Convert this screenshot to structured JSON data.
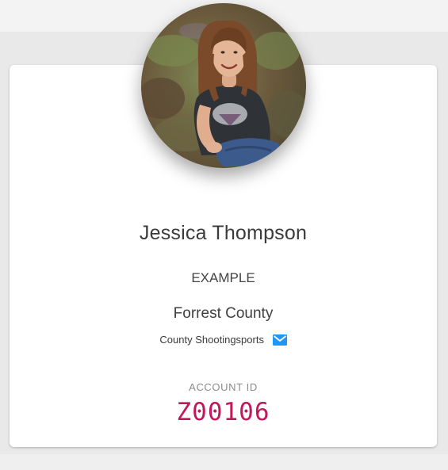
{
  "profile": {
    "name": "Jessica Thompson",
    "role": "EXAMPLE",
    "county": "Forrest County",
    "program": "County Shootingsports",
    "account_label": "ACCOUNT ID",
    "account_id": "Z00106"
  },
  "icons": {
    "contact": "mail-icon"
  },
  "colors": {
    "account_id": "#c2185b",
    "mail_icon": "#2196f3",
    "card_bg": "#ffffff",
    "page_bg": "#e9e9e9"
  }
}
